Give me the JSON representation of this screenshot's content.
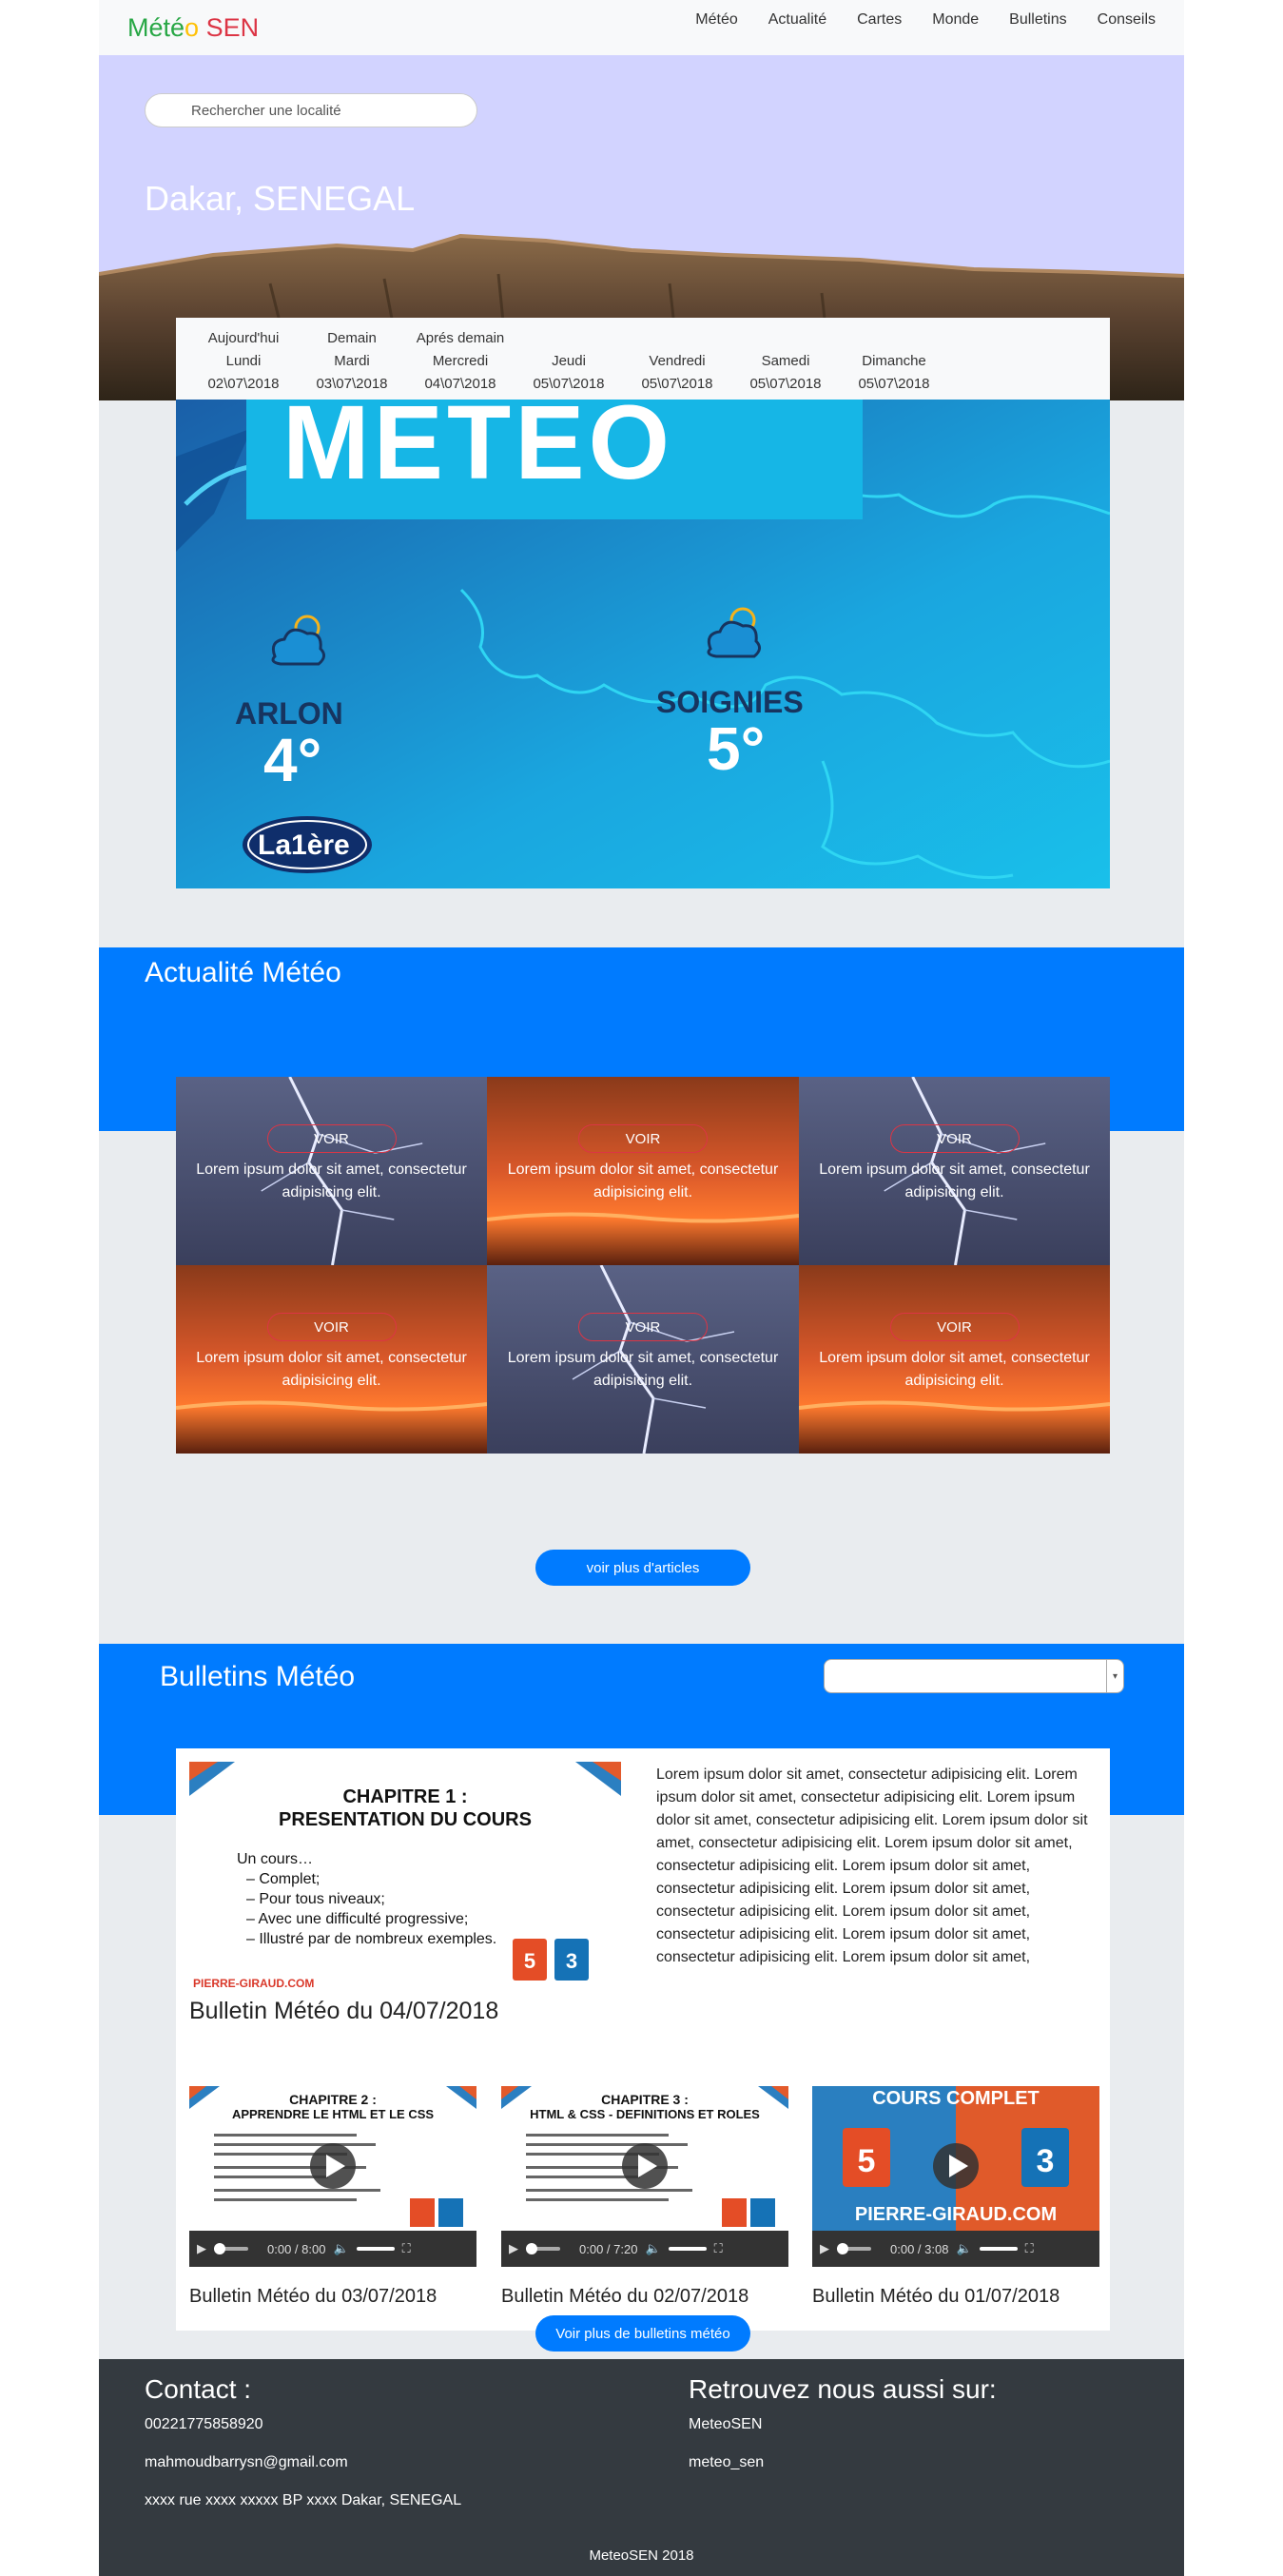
{
  "nav": {
    "brand_parts": [
      "Mété",
      "o",
      "SEN"
    ],
    "items": [
      "Météo",
      "Actualité",
      "Cartes",
      "Monde",
      "Bulletins",
      "Conseils"
    ]
  },
  "hero": {
    "search_placeholder": "Rechercher une localité",
    "city": "Dakar, SENEGAL"
  },
  "days": [
    {
      "top": "Aujourd'hui",
      "name": "Lundi",
      "date": "02\\07\\2018"
    },
    {
      "top": "Demain",
      "name": "Mardi",
      "date": "03\\07\\2018"
    },
    {
      "top": "Aprés demain",
      "name": "Mercredi",
      "date": "04\\07\\2018"
    },
    {
      "top": "",
      "name": "Jeudi",
      "date": "05\\07\\2018"
    },
    {
      "top": "",
      "name": "Vendredi",
      "date": "05\\07\\2018"
    },
    {
      "top": "",
      "name": "Samedi",
      "date": "05\\07\\2018"
    },
    {
      "top": "",
      "name": "Dimanche",
      "date": "05\\07\\2018"
    }
  ],
  "forecast_image": {
    "banner": "METEO",
    "cities": [
      {
        "name": "ARLON",
        "temp": "4°"
      },
      {
        "name": "SOIGNIES",
        "temp": "5°"
      }
    ],
    "logo": "La1ère"
  },
  "actu": {
    "title": "Actualité Météo",
    "cards": [
      {
        "button": "VOIR",
        "text": "Lorem ipsum dolor sit amet, consectetur adipisicing elit.",
        "theme": "storm"
      },
      {
        "button": "VOIR",
        "text": "Lorem ipsum dolor sit amet, consectetur adipisicing elit.",
        "theme": "sunset"
      },
      {
        "button": "VOIR",
        "text": "Lorem ipsum dolor sit amet, consectetur adipisicing elit.",
        "theme": "storm"
      },
      {
        "button": "VOIR",
        "text": "Lorem ipsum dolor sit amet, consectetur adipisicing elit.",
        "theme": "sunset"
      },
      {
        "button": "VOIR",
        "text": "Lorem ipsum dolor sit amet, consectetur adipisicing elit.",
        "theme": "storm"
      },
      {
        "button": "VOIR",
        "text": "Lorem ipsum dolor sit amet, consectetur adipisicing elit.",
        "theme": "sunset"
      }
    ],
    "more_button": "voir plus d'articles"
  },
  "bulletins": {
    "title": "Bulletins Météo",
    "select_value": "",
    "main": {
      "slide_title1": "CHAPITRE 1 :",
      "slide_title2": "PRESENTATION DU COURS",
      "bullets": [
        "Un cours…",
        "– Complet;",
        "– Pour tous niveaux;",
        "– Avec une difficulté progressive;",
        "– Illustré par de nombreux exemples."
      ],
      "site": "PIERRE-GIRAUD.COM",
      "label": "Bulletin Météo du 04/07/2018",
      "lorem": "Lorem ipsum dolor sit amet, consectetur adipisicing elit. Lorem ipsum dolor sit amet, consectetur adipisicing elit. Lorem ipsum dolor sit amet, consectetur adipisicing elit. Lorem ipsum dolor sit amet, consectetur adipisicing elit. Lorem ipsum dolor sit amet, consectetur adipisicing elit. Lorem ipsum dolor sit amet, consectetur adipisicing elit. Lorem ipsum dolor sit amet, consectetur adipisicing elit. Lorem ipsum dolor sit amet, consectetur adipisicing elit. Lorem ipsum dolor sit amet, consectetur adipisicing elit. Lorem ipsum dolor sit amet,"
    },
    "videos": [
      {
        "title1": "CHAPITRE 2 :",
        "title2": "APPRENDRE LE HTML ET LE CSS",
        "time": "0:00 / 8:00",
        "label": "Bulletin Météo du 03/07/2018"
      },
      {
        "title1": "CHAPITRE 3 :",
        "title2": "HTML & CSS - DEFINITIONS ET ROLES",
        "time": "0:00 / 7:20",
        "label": "Bulletin Météo du 02/07/2018"
      },
      {
        "title1": "COURS COMPLET",
        "title2": "PIERRE-GIRAUD.COM",
        "time": "0:00 / 3:08",
        "label": "Bulletin Météo du 01/07/2018"
      }
    ],
    "more_button": "Voir plus de bulletins météo"
  },
  "footer": {
    "contact_title": "Contact :",
    "phone": "00221775858920",
    "email": "mahmoudbarrysn@gmail.com",
    "address": "xxxx rue xxxx xxxxx BP xxxx Dakar, SENEGAL",
    "social_title": "Retrouvez nous aussi sur:",
    "social1": "MeteoSEN",
    "social2": "meteo_sen",
    "copyright": "MeteoSEN 2018"
  }
}
